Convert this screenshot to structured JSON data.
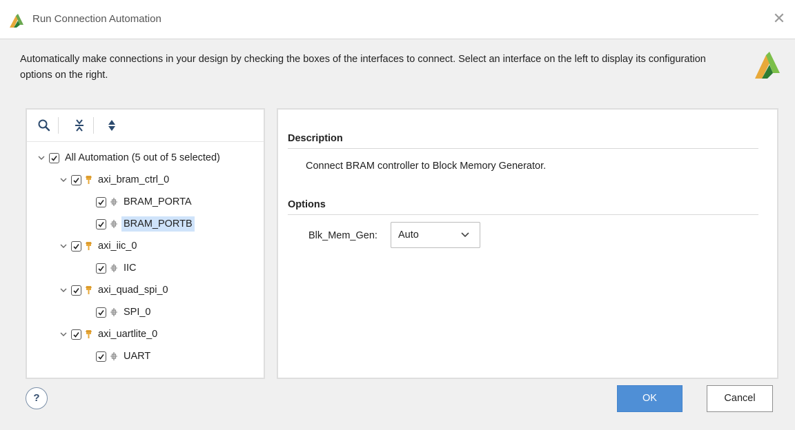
{
  "window": {
    "title": "Run Connection Automation",
    "close_icon": "close-icon"
  },
  "intro_text": "Automatically make connections in your design by checking the boxes of the interfaces to connect. Select an interface on the left to display its configuration options on the right.",
  "toolbar": {
    "icons": [
      "search-icon",
      "collapse-all-icon",
      "expand-all-icon"
    ]
  },
  "tree": {
    "root": {
      "label": "All Automation (5 out of 5 selected)",
      "checked": true,
      "expanded": true
    },
    "nodes": [
      {
        "label": "axi_bram_ctrl_0",
        "checked": true,
        "expanded": true,
        "icon": "ip-core-icon"
      },
      {
        "label": "BRAM_PORTA",
        "checked": true,
        "icon": "interface-icon"
      },
      {
        "label": "BRAM_PORTB",
        "checked": true,
        "icon": "interface-icon",
        "selected": true
      },
      {
        "label": "axi_iic_0",
        "checked": true,
        "expanded": true,
        "icon": "ip-core-icon"
      },
      {
        "label": "IIC",
        "checked": true,
        "icon": "interface-icon"
      },
      {
        "label": "axi_quad_spi_0",
        "checked": true,
        "expanded": true,
        "icon": "ip-core-icon"
      },
      {
        "label": "SPI_0",
        "checked": true,
        "icon": "interface-icon"
      },
      {
        "label": "axi_uartlite_0",
        "checked": true,
        "expanded": true,
        "icon": "ip-core-icon"
      },
      {
        "label": "UART",
        "checked": true,
        "icon": "interface-icon"
      }
    ]
  },
  "details": {
    "description_heading": "Description",
    "description_text": "Connect BRAM controller to Block Memory Generator.",
    "options_heading": "Options",
    "option_label": "Blk_Mem_Gen:",
    "option_value": "Auto"
  },
  "buttons": {
    "help": "?",
    "ok": "OK",
    "cancel": "Cancel"
  },
  "colors": {
    "accent": "#4f8fd6",
    "selection": "#cfe3fa",
    "ip_icon": "#e8a93a"
  }
}
